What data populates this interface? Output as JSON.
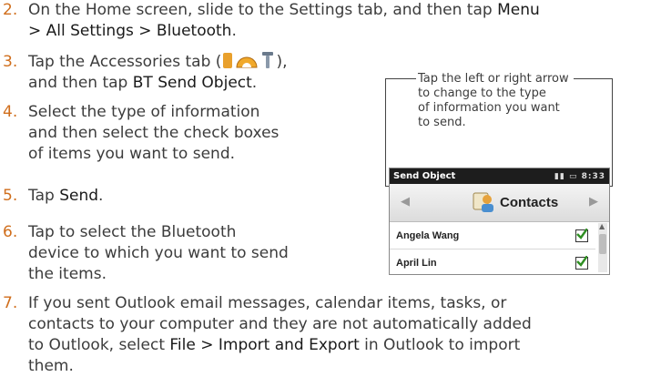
{
  "steps": {
    "s2": {
      "num": "2.",
      "line1_a": "On the Home screen, slide to the Settings tab, and then tap ",
      "line1_kw": "Menu",
      "line2": "> All Settings > Bluetooth",
      "line2_end": "."
    },
    "s3": {
      "num": "3.",
      "line1_a": "Tap the Accessories tab (",
      "line1_b": "),",
      "line2_a": "and then tap ",
      "line2_kw": "BT Send Object",
      "line2_end": "."
    },
    "s4": {
      "num": "4.",
      "line1": "Select the type of information",
      "line2": "and then select the check boxes",
      "line3": "of items you want to send."
    },
    "s5": {
      "num": "5.",
      "line1_a": "Tap ",
      "line1_kw": "Send",
      "line1_end": "."
    },
    "s6": {
      "num": "6.",
      "line1": "Tap to select the Bluetooth",
      "line2": "device to which you want to send",
      "line3": "the items."
    },
    "s7": {
      "num": "7.",
      "line1": "If you sent Outlook email messages, calendar items, tasks, or",
      "line2": "contacts to your computer and they are not automatically added",
      "line3_a": "to Outlook, select ",
      "line3_kw": "File > Import and Export",
      "line3_b": " in Outlook to import",
      "line4": "them."
    }
  },
  "callout": {
    "line1": "Tap the left or right arrow",
    "line2": "to change to the type",
    "line3": "of information you want",
    "line4": "to send."
  },
  "phone": {
    "title": "Send Object",
    "time": "8:33",
    "tab_label": "Contacts",
    "contacts": [
      "Angela Wang",
      "April Lin"
    ],
    "colors": {
      "status_bar": "#1d1d1d",
      "check": "#2f8f23"
    }
  },
  "colors": {
    "step_number": "#d06e1c",
    "body_text": "#3c3c3c"
  }
}
